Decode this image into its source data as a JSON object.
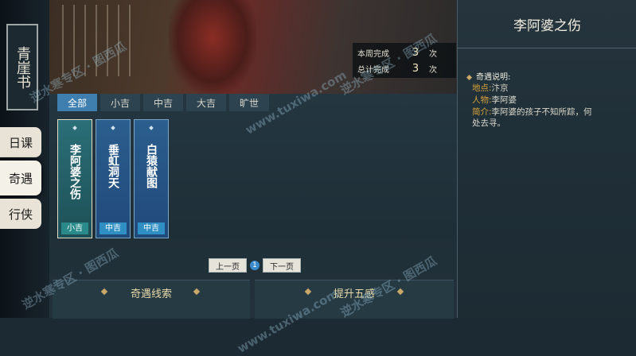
{
  "rail": {
    "book_title": "青崖书",
    "tabs": [
      {
        "label": "日课",
        "active": false
      },
      {
        "label": "奇遇",
        "active": true
      },
      {
        "label": "行侠",
        "active": false
      }
    ]
  },
  "banner": {
    "stats": [
      {
        "label": "本周完成",
        "value": "3",
        "unit": "次"
      },
      {
        "label": "总计完成",
        "value": "3",
        "unit": "次"
      }
    ]
  },
  "filters": [
    "全部",
    "小吉",
    "中吉",
    "大吉",
    "旷世"
  ],
  "cards": [
    {
      "name": "李阿婆之伤",
      "badge": "小吉",
      "selected": true
    },
    {
      "name": "垂虹洞天",
      "badge": "中吉",
      "selected": false
    },
    {
      "name": "白猿献图",
      "badge": "中吉",
      "selected": false
    }
  ],
  "pager": {
    "prev": "上一页",
    "page": "1",
    "next": "下一页"
  },
  "sections": [
    "奇遇线索",
    "提升五感"
  ],
  "detail": {
    "title": "李阿婆之伤",
    "heading": "奇遇说明:",
    "location_key": "地点:",
    "location": "汴京",
    "person_key": "人物:",
    "person": "李阿婆",
    "intro_key": "简介:",
    "intro": "李阿婆的孩子不知所踪，何处去寻。"
  },
  "watermarks": [
    "逆水寒专区 · 图西瓜",
    "www.tuxiwa.com"
  ],
  "colors": {
    "accent": "#3f7fb0",
    "gold": "#d6a23c",
    "card": "#2b5e8e"
  }
}
